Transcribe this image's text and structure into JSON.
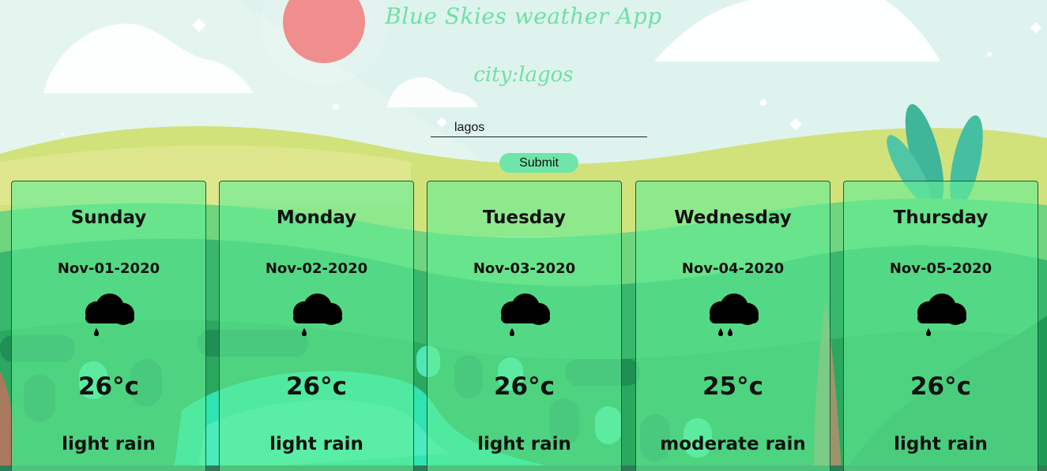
{
  "app": {
    "title": "Blue Skies weather App",
    "city_label": "city:lagos"
  },
  "search": {
    "value": "lagos",
    "placeholder": ""
  },
  "submit": {
    "label": "Submit"
  },
  "colors": {
    "accent": "#6fe0a6",
    "card_bg": "#64ee96",
    "sun": "#ee7b79"
  },
  "forecast": [
    {
      "day": "Sunday",
      "date": "Nov-01-2020",
      "temp": "26°c",
      "desc": "light rain",
      "icon": "light-rain-icon"
    },
    {
      "day": "Monday",
      "date": "Nov-02-2020",
      "temp": "26°c",
      "desc": "light rain",
      "icon": "light-rain-icon"
    },
    {
      "day": "Tuesday",
      "date": "Nov-03-2020",
      "temp": "26°c",
      "desc": "light rain",
      "icon": "light-rain-icon"
    },
    {
      "day": "Wednesday",
      "date": "Nov-04-2020",
      "temp": "25°c",
      "desc": "moderate rain",
      "icon": "moderate-rain-icon"
    },
    {
      "day": "Thursday",
      "date": "Nov-05-2020",
      "temp": "26°c",
      "desc": "light rain",
      "icon": "light-rain-icon"
    }
  ]
}
